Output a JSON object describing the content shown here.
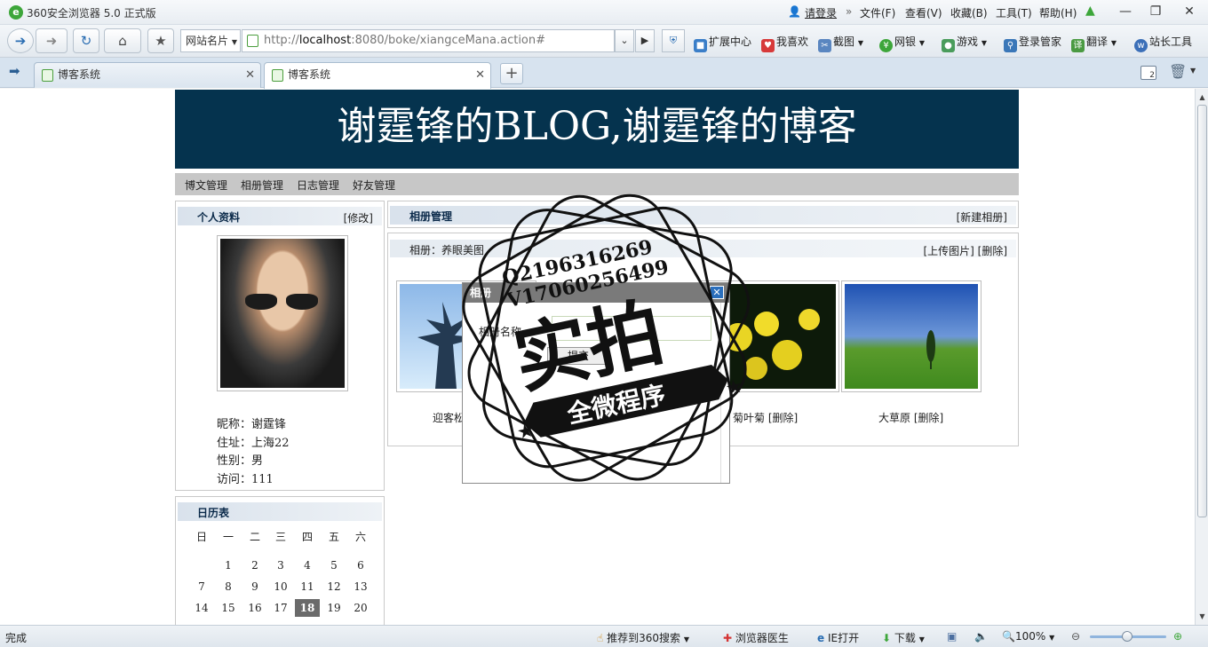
{
  "window": {
    "title": "360安全浏览器 5.0 正式版",
    "login": "请登录",
    "menu": [
      "文件(F)",
      "查看(V)",
      "收藏(B)",
      "工具(T)",
      "帮助(H)"
    ]
  },
  "toolbar": {
    "site_card": "网站名片",
    "url_prefix": "http://",
    "url_host": "localhost",
    "url_rest": ":8080/boke/xiangceMana.action#",
    "items": [
      "扩展中心",
      "我喜欢",
      "截图",
      "网银",
      "游戏",
      "登录管家",
      "翻译",
      "站长工具"
    ]
  },
  "tabs": [
    {
      "label": "博客系统",
      "active": false
    },
    {
      "label": "博客系统",
      "active": true
    }
  ],
  "tabbar_badge": "2",
  "page": {
    "banner": "谢霆锋的BLOG,谢霆锋的博客",
    "nav": [
      "博文管理",
      "相册管理",
      "日志管理",
      "好友管理"
    ],
    "profile": {
      "title": "个人资料",
      "edit": "[修改]",
      "nickname": "昵称：谢霆锋",
      "address": "住址：上海22",
      "gender": "性别：男",
      "visits": "访问：111"
    },
    "calendar": {
      "title": "日历表",
      "weekdays": [
        "日",
        "一",
        "二",
        "三",
        "四",
        "五",
        "六"
      ],
      "rows": [
        [
          "",
          "1",
          "2",
          "3",
          "4",
          "5",
          "6"
        ],
        [
          "7",
          "8",
          "9",
          "10",
          "11",
          "12",
          "13"
        ],
        [
          "14",
          "15",
          "16",
          "17",
          "18",
          "19",
          "20"
        ]
      ],
      "today": "18"
    },
    "album_mgmt": {
      "title": "相册管理",
      "new_album": "[新建相册]"
    },
    "album": {
      "name": "相册：养眼美图",
      "actions": "[上传图片] [删除]",
      "photos": [
        {
          "caption": "迎客松"
        },
        {
          "caption": "菊叶菊 [删除]"
        },
        {
          "caption": "大草原 [删除]"
        }
      ]
    },
    "dialog": {
      "title": "相册",
      "field_label": "相册名称",
      "button": "提交"
    },
    "watermark": {
      "line1": "Q2196316269",
      "line2": "V17060256499",
      "big": "实拍",
      "ribbon": "全微程序"
    }
  },
  "statusbar": {
    "status": "完成",
    "recommend": "推荐到360搜索",
    "doctor": "浏览器医生",
    "ie_open": "IE打开",
    "download": "下载",
    "zoom": "100%"
  }
}
